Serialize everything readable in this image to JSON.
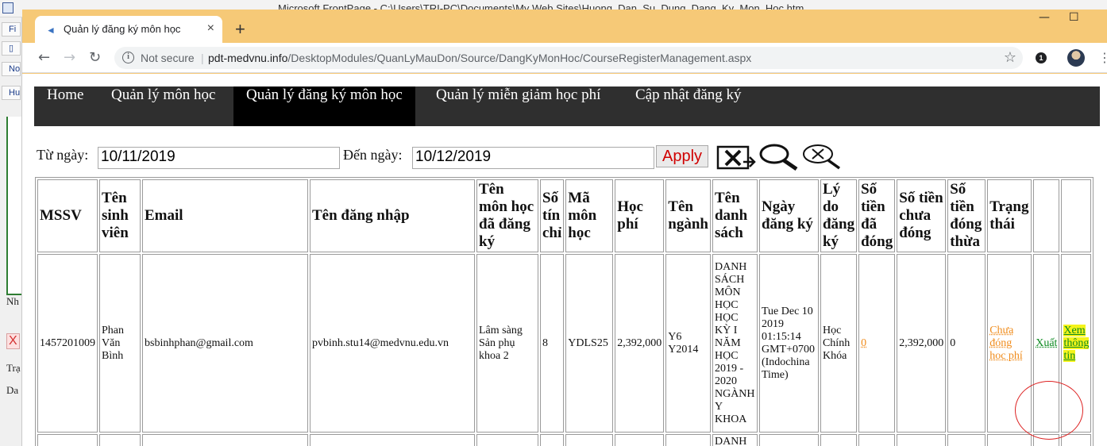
{
  "frontpage": {
    "window_title": "Microsoft FrontPage - C:\\Users\\TRI-PC\\Documents\\My Web Sites\\Huong_Dan_Su_Dung_Dang_Ky_Mon_Hoc.htm",
    "toolbar_items": [
      "Fi",
      "",
      "No",
      "Hu"
    ],
    "side_texts": [
      "Nh",
      "X",
      "Trạ",
      "Da"
    ]
  },
  "browser": {
    "tab_title": "Quản lý đăng ký môn học",
    "tab_close": "×",
    "new_tab": "+",
    "win_min": "—",
    "win_max": "☐",
    "nav_back": "←",
    "nav_forward": "→",
    "nav_reload": "↻",
    "not_secure": "Not secure",
    "separator": "|",
    "url_host": "pdt-medvnu.info",
    "url_path": "/DesktopModules/QuanLyMauDon/Source/DangKyMonHoc/CourseRegisterManagement.aspx",
    "star_icon": "☆",
    "ext_badge": "1",
    "kebab": "⋮"
  },
  "menu": {
    "items": [
      {
        "label": "Home"
      },
      {
        "label": "Quản lý môn học"
      },
      {
        "label": "Quản lý đăng ký môn học"
      },
      {
        "label": "Quản lý miễn giảm học phí"
      },
      {
        "label": "Cập nhật đăng ký"
      }
    ],
    "active_index": 2
  },
  "filter": {
    "from_label": "Từ ngày:",
    "from_value": "10/11/2019",
    "to_label": "Đến ngày:",
    "to_value": "10/12/2019",
    "apply_label": "Apply",
    "icons": [
      "excel-export-icon",
      "search-icon",
      "clear-search-icon"
    ]
  },
  "table": {
    "headers": [
      "MSSV",
      "Tên sinh viên",
      "Email",
      "Tên đăng nhập",
      "Tên môn học đã đăng ký",
      "Số tín chỉ",
      "Mã môn học",
      "Học phí",
      "Tên ngành",
      "Tên danh sách",
      "Ngày đăng ký",
      "Lý do đăng ký",
      "Số tiền đã đóng",
      "Số tiền chưa đóng",
      "Số tiền đóng thừa",
      "Trạng thái",
      "",
      ""
    ],
    "row": {
      "mssv": "1457201009",
      "ten_sinh_vien": "Phan Văn Bình",
      "email": "bsbinhphan@gmail.com",
      "ten_dang_nhap": "pvbinh.stu14@medvnu.edu.vn",
      "ten_mon_hoc": "Lâm sàng Sản phụ khoa 2",
      "so_tin_chi": "8",
      "ma_mon_hoc": "YDLS25",
      "hoc_phi": "2,392,000",
      "ten_nganh": "Y6 Y2014",
      "ten_danh_sach": "DANH SÁCH MÔN HỌC HỌC KỲ I NĂM HỌC 2019 - 2020 NGÀNH Y KHOA",
      "ngay_dang_ky": "Tue Dec 10 2019 01:15:14 GMT+0700 (Indochina Time)",
      "ly_do": "Học Chính Khóa",
      "da_dong": "0",
      "chua_dong": "2,392,000",
      "dong_thua": "0",
      "trang_thai": "Chưa đóng học phí",
      "xuat": "Xuất",
      "xem": "Xem thông tin"
    },
    "next_row_partial": "DANH"
  },
  "colors": {
    "chrome_frame": "#f6c977",
    "menubar": "#2f2f2f",
    "menu_active": "#000000",
    "apply_text": "#d00000",
    "status_orange": "#f08c1c",
    "link_green": "#0c8a20",
    "highlight_yellow": "#f4f31a",
    "annotation_red": "#dd2222"
  }
}
